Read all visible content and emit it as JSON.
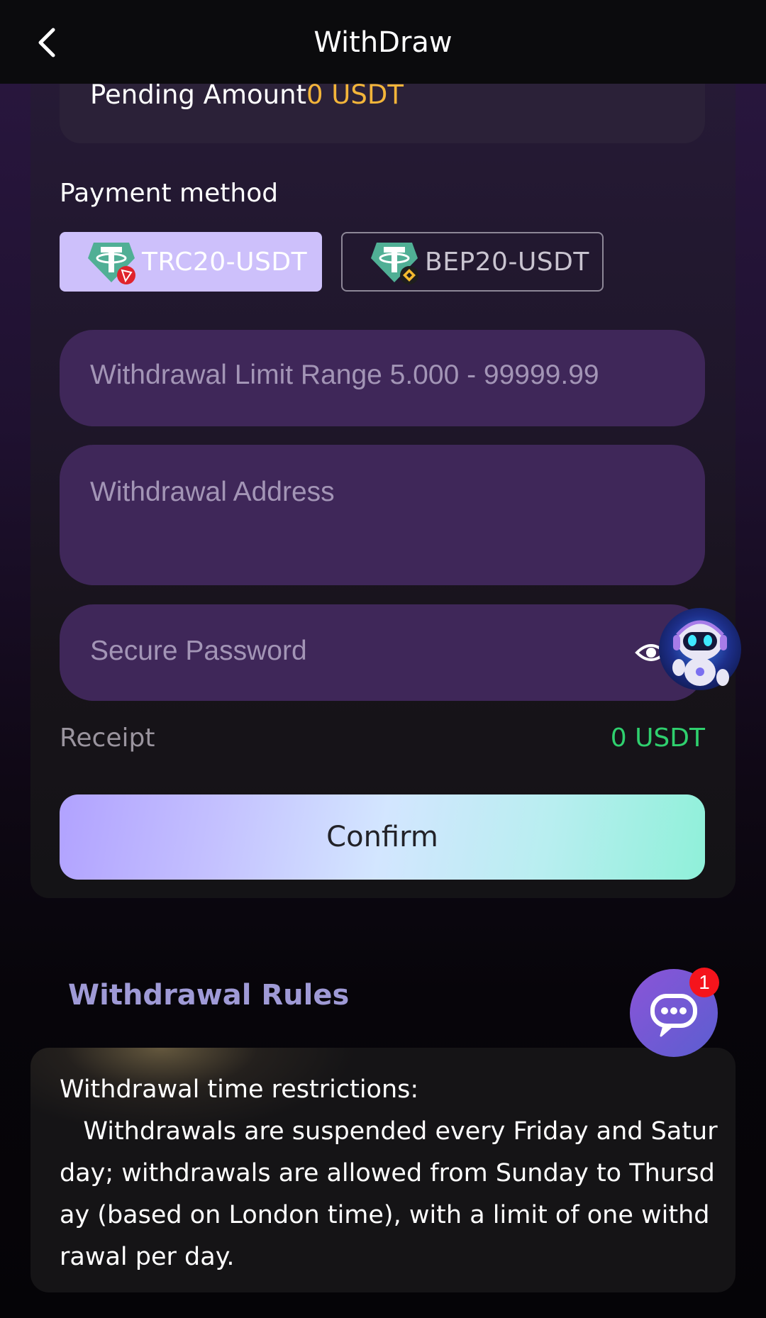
{
  "header": {
    "title": "WithDraw",
    "back_icon": "chevron-left-icon"
  },
  "pending": {
    "label": "Pending Amount",
    "value": "0 USDT"
  },
  "payment": {
    "label": "Payment method",
    "methods": [
      {
        "label": "TRC20-USDT",
        "icon": "tether-trc20-icon",
        "selected": true
      },
      {
        "label": "BEP20-USDT",
        "icon": "tether-bep20-icon",
        "selected": false
      }
    ]
  },
  "form": {
    "amount_placeholder": "Withdrawal Limit Range 5.000 - 99999.99",
    "address_placeholder": "Withdrawal Address",
    "password_placeholder": "Secure Password"
  },
  "receipt": {
    "label": "Receipt",
    "value": "0 USDT"
  },
  "confirm_label": "Confirm",
  "rules": {
    "title": "Withdrawal Rules",
    "text": "Withdrawal time restrictions:\n   Withdrawals are suspended every Friday and Saturday; withdrawals are allowed from Sunday to Thursday (based on London time), with a limit of one withdrawal per day."
  },
  "chat": {
    "badge": "1",
    "icon": "chat-bubble-icon"
  },
  "colors": {
    "accent_yellow": "#f3b53a",
    "accent_green": "#2fd06e",
    "selected_method": "#cdc0fb",
    "field_bg": "#3f2759"
  }
}
